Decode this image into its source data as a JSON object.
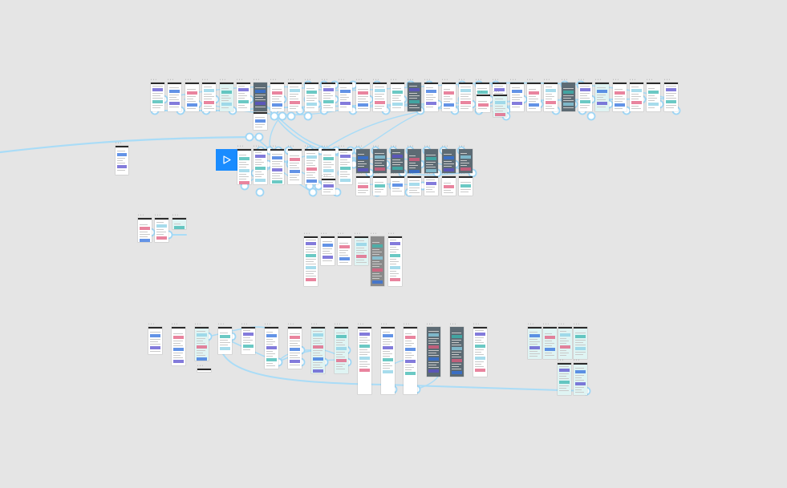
{
  "canvas": {
    "background": "#e5e5e5",
    "connector_color": "#a9dcf7",
    "node_fill": "#ffffff",
    "node_stroke": "#9fd6f5",
    "start_button_color": "#1a8cff",
    "frame_label": "• • •"
  },
  "prototype": {
    "start_icon": "play-icon"
  }
}
